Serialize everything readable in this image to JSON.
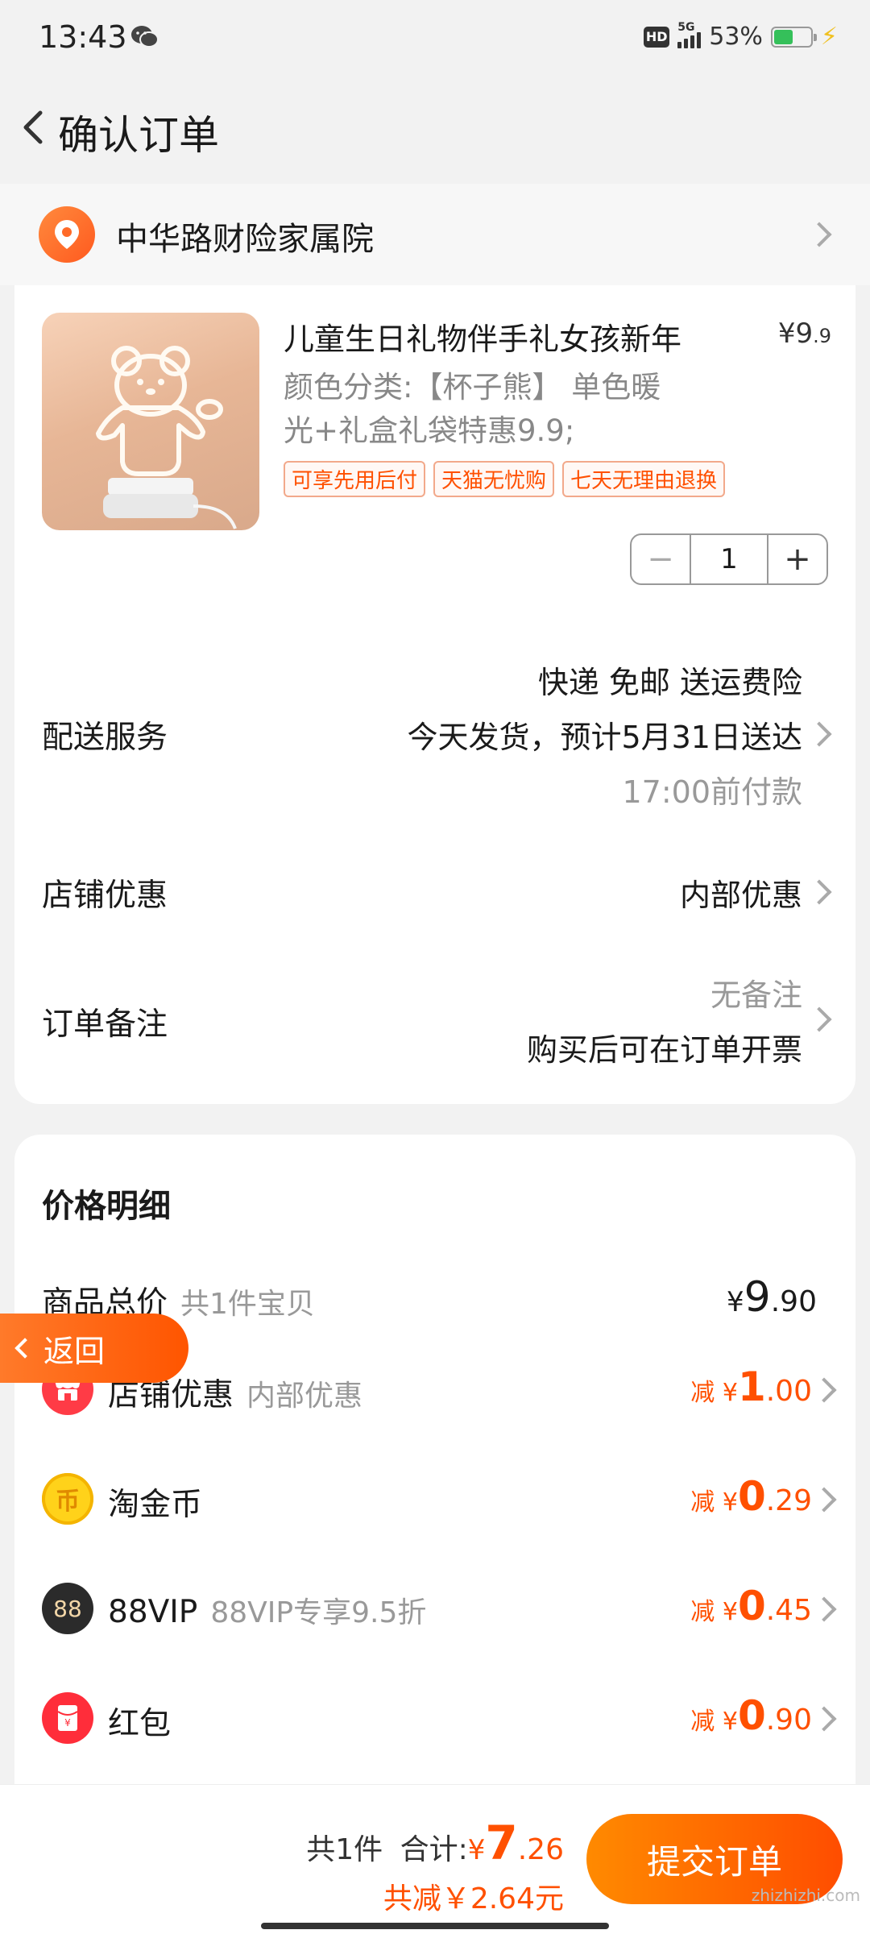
{
  "status_bar": {
    "time": "13:43",
    "network": "5G",
    "hd_badge": "HD",
    "battery_percent": "53%",
    "battery_level": 0.53,
    "icons": [
      "wechat-icon",
      "hd-icon",
      "signal-icon",
      "battery-icon",
      "charging-icon"
    ]
  },
  "header": {
    "title": "确认订单"
  },
  "address": {
    "text": "中华路财险家属院"
  },
  "product": {
    "title": "儿童生日礼物伴手礼女孩新年",
    "price_symbol": "¥",
    "price_int": "9",
    "price_dec": ".9",
    "sku_line1": "颜色分类:【杯子熊】 单色暖",
    "sku_line2": "光+礼盒礼袋特惠9.9;",
    "tags": [
      "可享先用后付",
      "天猫无忧购",
      "七天无理由退换"
    ],
    "quantity": "1",
    "minus": "−",
    "plus": "+"
  },
  "delivery": {
    "label": "配送服务",
    "line1": "快递 免邮 送运费险",
    "line2": "今天发货，预计5月31日送达",
    "line3": "17:00前付款"
  },
  "shop_discount": {
    "label": "店铺优惠",
    "value": "内部优惠"
  },
  "order_note": {
    "label": "订单备注",
    "placeholder": "无备注",
    "invoice": "购买后可在订单开票"
  },
  "price_detail": {
    "title": "价格明细",
    "goods_total": {
      "label": "商品总价",
      "sub": "共1件宝贝",
      "symbol": "¥",
      "int": "9",
      "dec": ".90"
    },
    "items": [
      {
        "label": "店铺优惠",
        "sub": "内部优惠",
        "prefix": "减",
        "symbol": "¥",
        "int": "1",
        "dec": ".00"
      },
      {
        "label": "淘金币",
        "sub": "",
        "prefix": "减",
        "symbol": "¥",
        "int": "0",
        "dec": ".29"
      },
      {
        "label": "88VIP",
        "sub": "88VIP专享9.5折",
        "prefix": "减",
        "symbol": "¥",
        "int": "0",
        "dec": ".45"
      },
      {
        "label": "红包",
        "sub": "",
        "prefix": "减",
        "symbol": "¥",
        "int": "0",
        "dec": ".90"
      }
    ]
  },
  "float_back": {
    "label": "返回"
  },
  "bottom": {
    "count": "共1件",
    "sum_label": "合计:",
    "symbol": "¥",
    "total_int": "7",
    "total_dec": ".26",
    "saved": "共减￥2.64元",
    "submit": "提交订单"
  },
  "watermark": "zhizhizhi.com",
  "colors": {
    "accent": "#ff5000",
    "background": "#f2f2f2",
    "card": "#ffffff",
    "muted": "#999999"
  }
}
